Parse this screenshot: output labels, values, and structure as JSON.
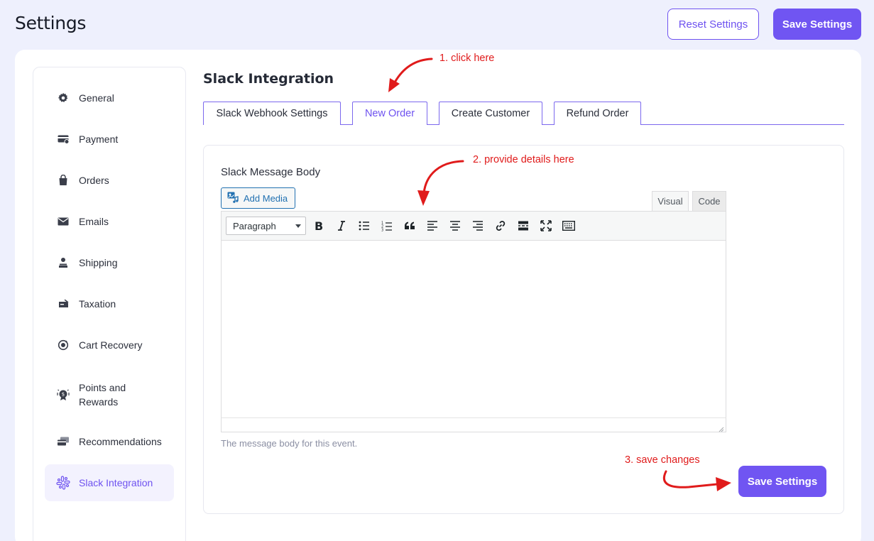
{
  "header": {
    "title": "Settings",
    "reset_label": "Reset Settings",
    "save_label": "Save Settings"
  },
  "sidebar": {
    "items": [
      {
        "label": "General",
        "icon": "gear-icon"
      },
      {
        "label": "Payment",
        "icon": "credit-card-icon"
      },
      {
        "label": "Orders",
        "icon": "shopping-bag-icon"
      },
      {
        "label": "Emails",
        "icon": "envelope-icon"
      },
      {
        "label": "Shipping",
        "icon": "shipping-person-icon"
      },
      {
        "label": "Taxation",
        "icon": "tax-ticket-icon"
      },
      {
        "label": "Cart Recovery",
        "icon": "cart-recovery-icon"
      },
      {
        "label": "Points and Rewards",
        "icon": "reward-badge-icon"
      },
      {
        "label": "Recommendations",
        "icon": "recommendation-cards-icon"
      },
      {
        "label": "Slack Integration",
        "icon": "slack-icon",
        "active": true
      }
    ]
  },
  "main": {
    "section_title": "Slack Integration",
    "tabs": [
      {
        "label": "Slack Webhook Settings"
      },
      {
        "label": "New Order",
        "active": true
      },
      {
        "label": "Create Customer"
      },
      {
        "label": "Refund Order"
      }
    ],
    "field_label": "Slack Message Body",
    "add_media_label": "Add Media",
    "editor_modes": {
      "visual": "Visual",
      "code": "Code"
    },
    "format_select": "Paragraph",
    "toolbar_icons": [
      "bold-icon",
      "italic-icon",
      "bullet-list-icon",
      "numbered-list-icon",
      "blockquote-icon",
      "align-left-icon",
      "align-center-icon",
      "align-right-icon",
      "link-icon",
      "read-more-icon",
      "fullscreen-icon",
      "toolbar-toggle-icon"
    ],
    "editor_content": "",
    "help_text": "The message body for this event.",
    "save_label": "Save Settings"
  },
  "annotations": {
    "step1": "1. click here",
    "step2": "2. provide details here",
    "step3": "3. save changes",
    "color": "#e01b1b"
  },
  "colors": {
    "accent": "#7055f2",
    "background": "#eef0fd",
    "wp_blue": "#2271b1"
  }
}
